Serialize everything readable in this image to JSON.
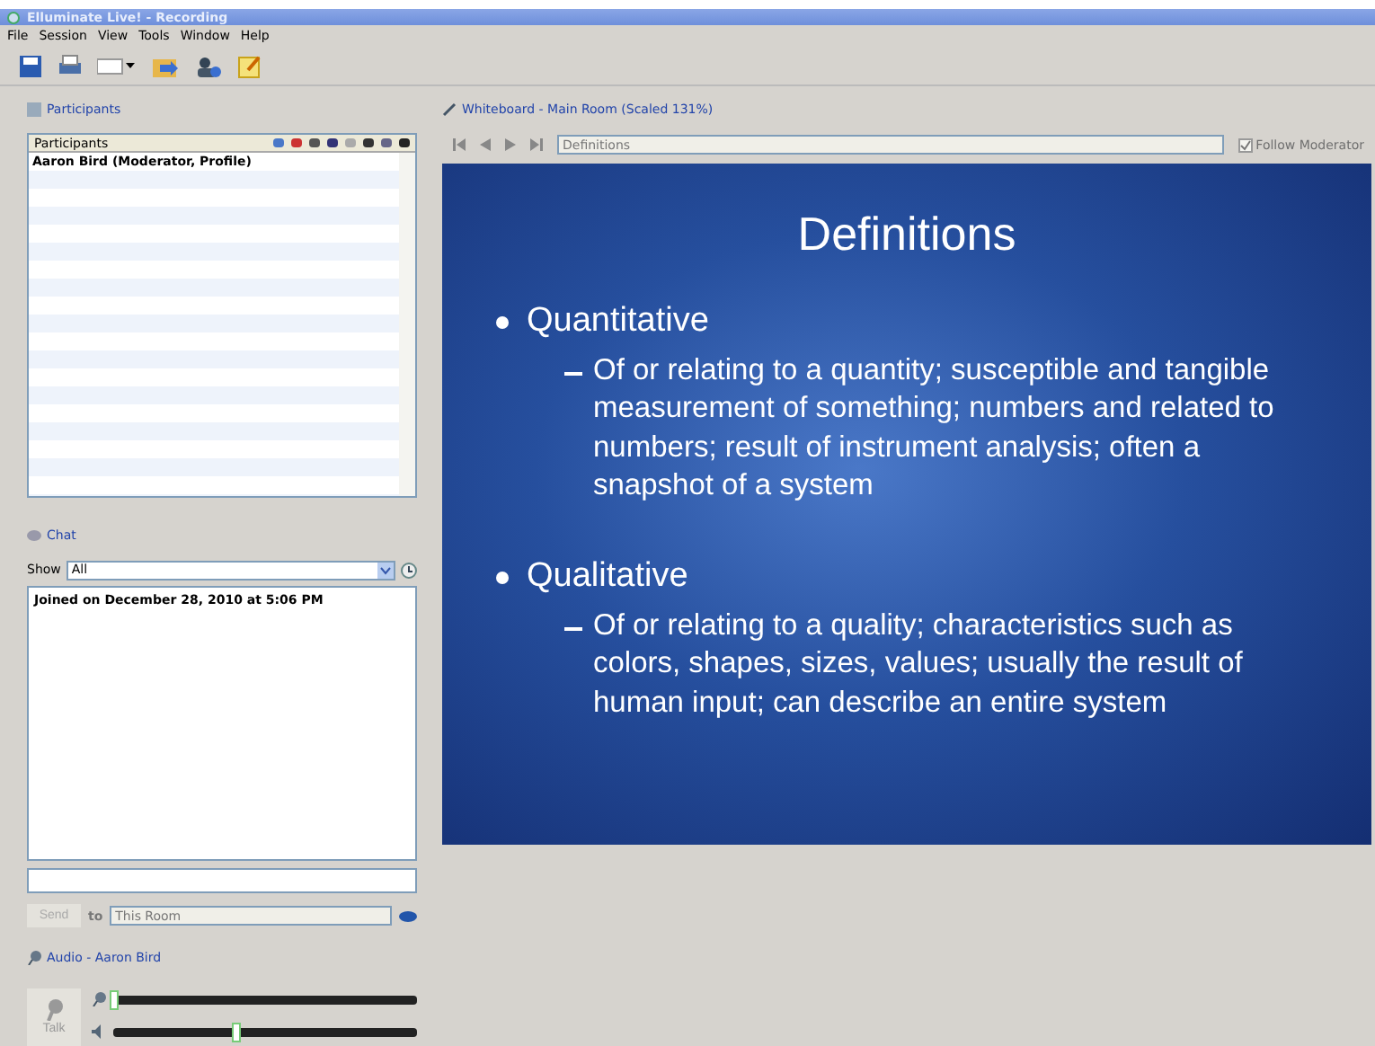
{
  "window": {
    "title": "Elluminate Live! - Recording"
  },
  "menu": [
    "File",
    "Session",
    "View",
    "Tools",
    "Window",
    "Help"
  ],
  "participants": {
    "title": "Participants",
    "column": "Participants",
    "rows": [
      {
        "name": "Aaron Bird (Moderator, Profile)"
      }
    ]
  },
  "chat": {
    "title": "Chat",
    "show_label": "Show",
    "filter": "All",
    "messages": [
      "Joined on December 28, 2010 at 5:06 PM"
    ],
    "send": "Send",
    "to_label": "to",
    "recipient": "This Room"
  },
  "audio": {
    "title": "Audio - Aaron Bird",
    "talk": "Talk",
    "mic": {
      "level": 0
    },
    "speaker": {
      "level": 0.4
    }
  },
  "whiteboard": {
    "title": "Whiteboard - Main Room (Scaled 131%)",
    "page": "Definitions",
    "follow_moderator": {
      "label": "Follow Moderator",
      "checked": true
    },
    "slide": {
      "title": "Definitions",
      "bullets": [
        {
          "heading": "Quantitative",
          "sub": "Of or relating to a quantity; susceptible and tangible measurement of something; numbers and related to numbers; result of instrument analysis; often a snapshot of a system"
        },
        {
          "heading": "Qualitative",
          "sub": "Of or relating to a quality; characteristics such as colors, shapes, sizes, values; usually the result of human input; can describe an entire system"
        }
      ]
    }
  }
}
